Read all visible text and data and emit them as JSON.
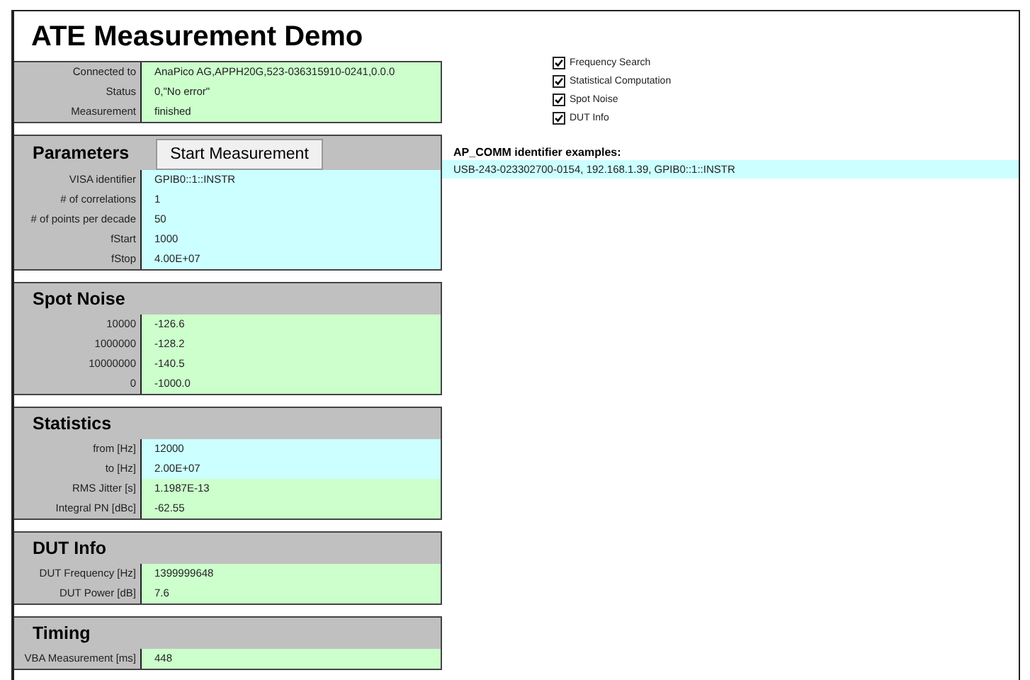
{
  "title": "ATE Measurement Demo",
  "connection": [
    {
      "label": "Connected to",
      "value": "AnaPico AG,APPH20G,523-036315910-0241,0.0.0",
      "kind": "output"
    },
    {
      "label": "Status",
      "value": "0,\"No error\"",
      "kind": "output"
    },
    {
      "label": "Measurement",
      "value": "finished",
      "kind": "output"
    }
  ],
  "sections": [
    {
      "title": "Parameters",
      "button": "Start Measurement",
      "rows": [
        {
          "label": "VISA identifier",
          "value": "GPIB0::1::INSTR",
          "kind": "input"
        },
        {
          "label": "# of correlations",
          "value": "1",
          "kind": "input"
        },
        {
          "label": "# of points per decade",
          "value": "50",
          "kind": "input"
        },
        {
          "label": "fStart",
          "value": "1000",
          "kind": "input"
        },
        {
          "label": "fStop",
          "value": "4.00E+07",
          "kind": "input"
        }
      ]
    },
    {
      "title": "Spot Noise",
      "rows": [
        {
          "label": "10000",
          "value": "-126.6",
          "kind": "output"
        },
        {
          "label": "1000000",
          "value": "-128.2",
          "kind": "output"
        },
        {
          "label": "10000000",
          "value": "-140.5",
          "kind": "output"
        },
        {
          "label": "0",
          "value": "-1000.0",
          "kind": "output"
        }
      ]
    },
    {
      "title": "Statistics",
      "rows": [
        {
          "label": "from [Hz]",
          "value": "12000",
          "kind": "input"
        },
        {
          "label": "to [Hz]",
          "value": "2.00E+07",
          "kind": "input"
        },
        {
          "label": "RMS Jitter [s]",
          "value": "1.1987E-13",
          "kind": "output"
        },
        {
          "label": "Integral PN [dBc]",
          "value": "-62.55",
          "kind": "output"
        }
      ]
    },
    {
      "title": "DUT Info",
      "rows": [
        {
          "label": "DUT Frequency [Hz]",
          "value": "1399999648",
          "kind": "output"
        },
        {
          "label": "DUT Power [dB]",
          "value": "7.6",
          "kind": "output"
        }
      ]
    },
    {
      "title": "Timing",
      "rows": [
        {
          "label": "VBA Measurement [ms]",
          "value": "448",
          "kind": "output"
        }
      ]
    }
  ],
  "options": [
    {
      "label": "Frequency Search",
      "checked": true
    },
    {
      "label": "Statistical Computation",
      "checked": true
    },
    {
      "label": "Spot Noise",
      "checked": true
    },
    {
      "label": "DUT Info",
      "checked": true
    }
  ],
  "identifier_examples": {
    "heading": "AP_COMM identifier examples:",
    "text": "USB-243-023302700-0154, 192.168.1.39, GPIB0::1::INSTR"
  }
}
